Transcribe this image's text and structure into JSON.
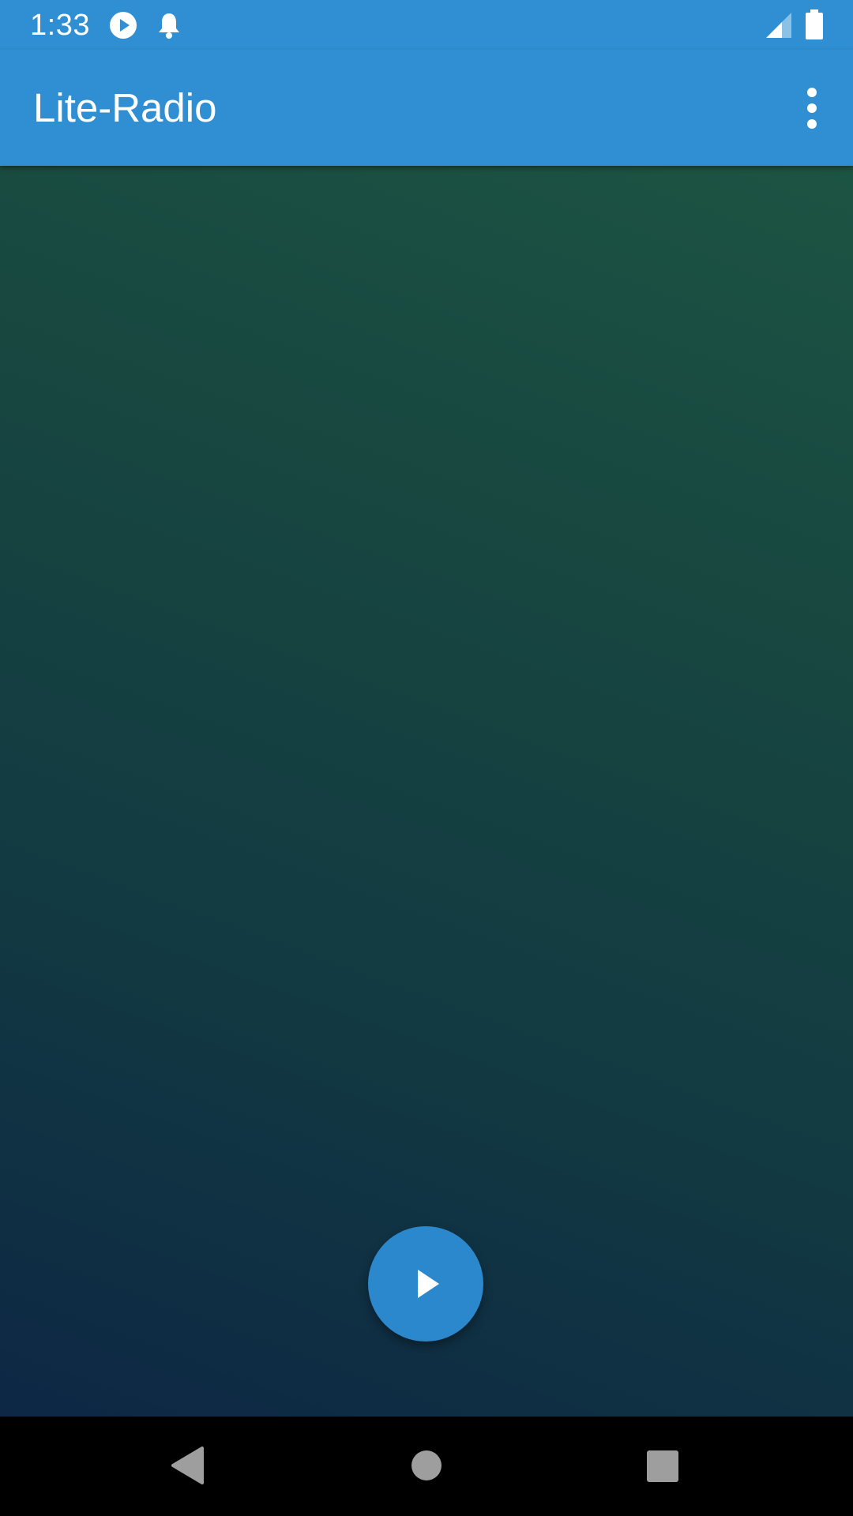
{
  "status_bar": {
    "time": "1:33",
    "icons": [
      "media-play-icon",
      "notification-bell-icon",
      "signal-icon",
      "battery-icon"
    ]
  },
  "app_bar": {
    "title": "Lite-Radio",
    "overflow_icon": "more-vert-icon"
  },
  "player": {
    "fab_icon": "play-icon"
  },
  "nav_bar": {
    "icons": [
      "back-icon",
      "home-icon",
      "recents-icon"
    ]
  },
  "colors": {
    "primary": "#2f8fd2",
    "fab": "#2b88cc",
    "gradient_top": "#1c5443",
    "gradient_bottom": "#0d2744"
  }
}
